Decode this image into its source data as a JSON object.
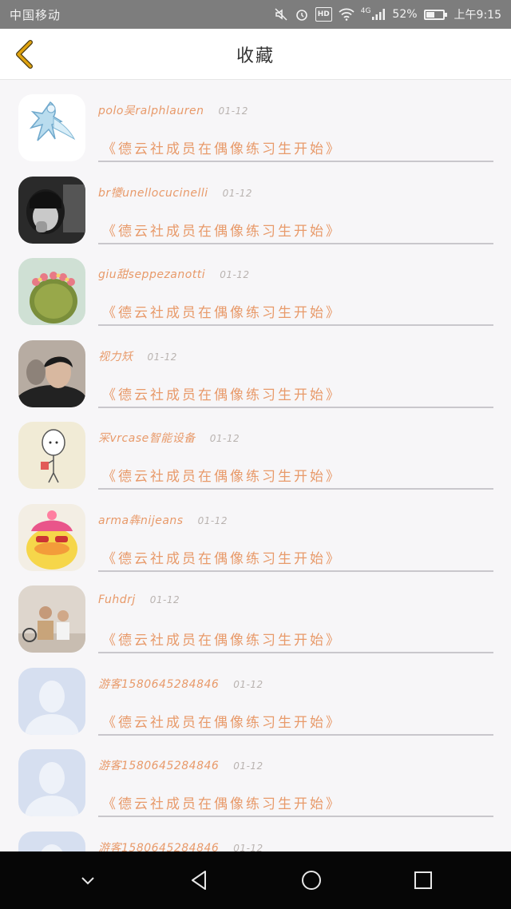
{
  "status_bar": {
    "carrier": "中国移动",
    "network": "4G",
    "battery": "52%",
    "battery_level": 0.52,
    "time": "上午9:15"
  },
  "header": {
    "title": "收藏",
    "back_icon": "chevron-left-icon",
    "accent_color": "#e0a30f"
  },
  "favorites": [
    {
      "name": "polo吴ralphlauren",
      "date": "01-12",
      "content": "《德云社成员在偶像练习生开始》",
      "avatar": "crystal-figure"
    },
    {
      "name": "br犪unellocucinelli",
      "date": "01-12",
      "content": "《德云社成员在偶像练习生开始》",
      "avatar": "bw-portrait"
    },
    {
      "name": "giu甜seppezanotti",
      "date": "01-12",
      "content": "《德云社成员在偶像练习生开始》",
      "avatar": "cactus"
    },
    {
      "name": "视力矨",
      "date": "01-12",
      "content": "《德云社成员在偶像练习生开始》",
      "avatar": "man-portrait"
    },
    {
      "name": "冞vrcase智能设备",
      "date": "01-12",
      "content": "《德云社成员在偶像练习生开始》",
      "avatar": "doodle-figure"
    },
    {
      "name": "arma犇nijeans",
      "date": "01-12",
      "content": "《德云社成员在偶像练习生开始》",
      "avatar": "yellow-duck"
    },
    {
      "name": "Fuhdrj",
      "date": "01-12",
      "content": "《德云社成员在偶像练习生开始》",
      "avatar": "two-men"
    },
    {
      "name": "游客1580645284846",
      "date": "01-12",
      "content": "《德云社成员在偶像练习生开始》",
      "avatar": "default-user"
    },
    {
      "name": "游客1580645284846",
      "date": "01-12",
      "content": "《德云社成员在偶像练习生开始》",
      "avatar": "default-user"
    },
    {
      "name": "游客1580645284846",
      "date": "01-12",
      "content": "",
      "avatar": "default-user"
    }
  ],
  "nav_bar": {
    "buttons": [
      "hide-keyboard-icon",
      "back-triangle-icon",
      "home-circle-icon",
      "recents-square-icon"
    ]
  }
}
